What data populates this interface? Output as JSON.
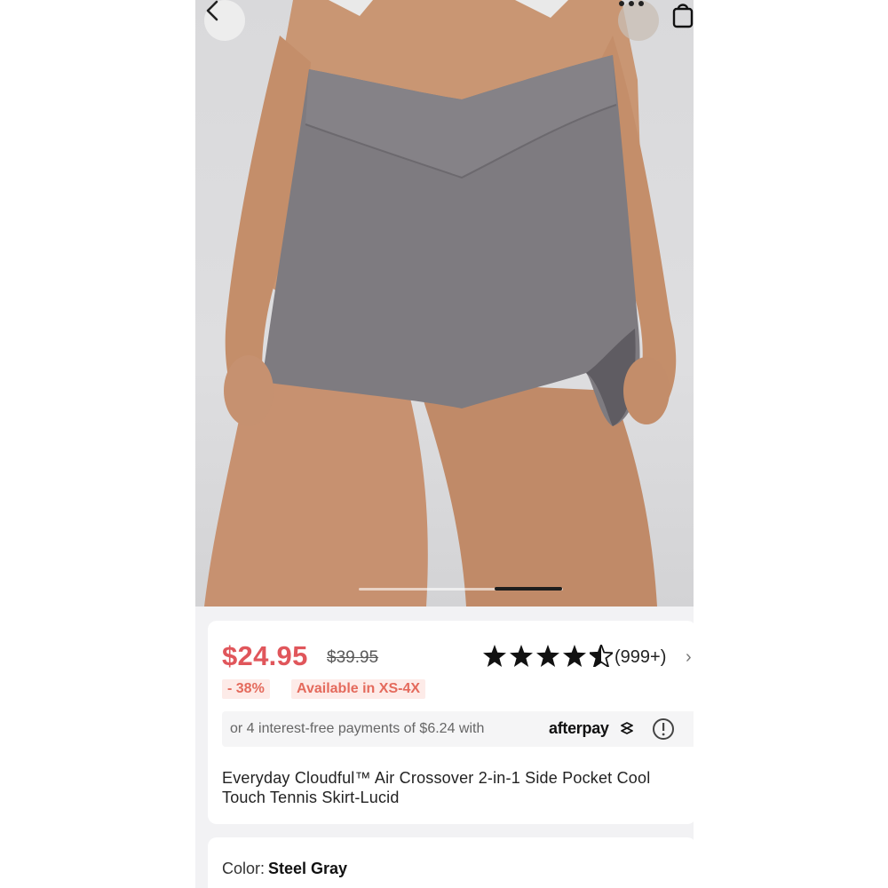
{
  "product": {
    "price_now": "$24.95",
    "price_old": "$39.95",
    "rating_stars": 4.5,
    "rating_count": "(999+)",
    "discount": "- 38%",
    "availability": "Available in XS-4X",
    "afterpay_text": "or 4 interest-free payments of $6.24 with",
    "afterpay_brand": "afterpay",
    "title": "Everyday Cloudful™ Air Crossover 2-in-1 Side Pocket Cool Touch Tennis Skirt-Lucid",
    "color_label": "Color:",
    "color_value": "Steel Gray"
  },
  "icons": {
    "back": "chevron-left-icon",
    "more": "more-dots-icon",
    "bag": "shopping-bag-icon",
    "star": "star-icon",
    "info": "info-icon"
  },
  "carousel": {
    "current_index": 2,
    "total": 2
  },
  "colors": {
    "price_red": "#e0565b",
    "badge_bg": "#fdebe8",
    "badge_text": "#e46a5c",
    "skirt_gray": "#7e7b80"
  }
}
